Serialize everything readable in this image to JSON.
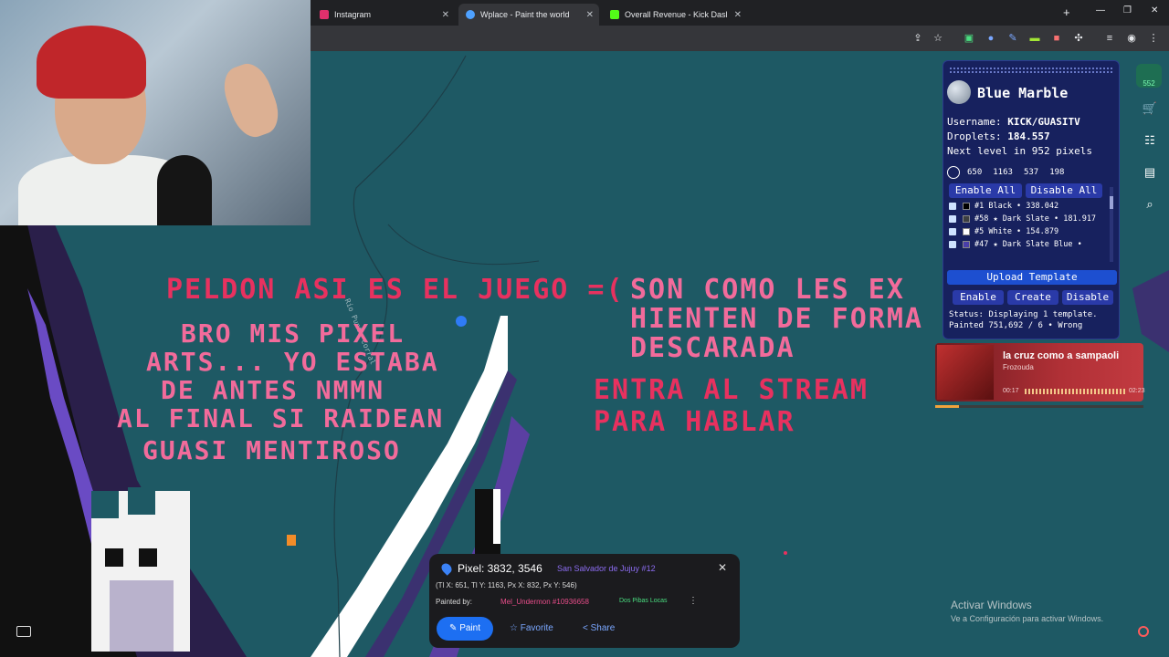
{
  "browser": {
    "tabs": [
      {
        "label": "Instagram",
        "color": "#e1306c"
      },
      {
        "label": "Wplace - Paint the world",
        "color": "#4ea1ff"
      },
      {
        "label": "Overall Revenue - Kick Dashbo",
        "color": "#53fc18"
      }
    ]
  },
  "canvas_text": {
    "line1a": "PELDON ASI ES EL JUEGO =(",
    "line1b": "SON COMO LES EX",
    "line2": "HIENTEN DE FORMA",
    "line3": "DESCARADA",
    "left1": "BRO MIS PIXEL",
    "left2": "ARTS... YO ESTABA",
    "left3": "DE ANTES NMMN",
    "left4": "AL FINAL SI RAIDEAN",
    "left5": "GUASI MENTIROSO",
    "right1": "ENTRA AL STREAM",
    "right2": "PARA HABLAR",
    "road": "Río Punta Corral"
  },
  "blue_marble": {
    "title": "Blue Marble",
    "username_label": "Username:",
    "username": "KICK/GUASITV",
    "droplets_label": "Droplets:",
    "droplets": "184.557",
    "next_level": "Next level in 952 pixels",
    "stats": [
      "650",
      "1163",
      "537",
      "198"
    ],
    "enable_all": "Enable All",
    "disable_all": "Disable All",
    "colors": [
      {
        "label": "#1 Black • 338.042",
        "swatch": "#000000"
      },
      {
        "label": "#58 ★ Dark Slate • 181.917",
        "swatch": "#3c3f41"
      },
      {
        "label": "#5 White • 154.879",
        "swatch": "#ffffff"
      },
      {
        "label": "#47 ★ Dark Slate Blue •",
        "swatch": "#4a3ea8"
      }
    ],
    "upload": "Upload Template",
    "enable": "Enable",
    "create": "Create",
    "disable": "Disable",
    "status": "Status: Displaying 1 template. Painted 751,692 / 6 • Wrong"
  },
  "sidebar": {
    "badge": "552"
  },
  "music": {
    "title": "la cruz como a sampaoli",
    "artist": "Frozouda",
    "elapsed": "00:17",
    "total": "02:23"
  },
  "pixel_info": {
    "coord": "Pixel: 3832, 3546",
    "place": "San Salvador de Jujuy #12",
    "tile": "(Tl X: 651, Tl Y: 1163, Px X: 832, Px Y: 546)",
    "painted_by": "Painted by:",
    "user": "Mel_Undermon #10936658",
    "alliance": "Dos Pibas Locas",
    "paint": "Paint",
    "favorite": "Favorite",
    "share": "Share"
  },
  "windows": {
    "line1": "Activar Windows",
    "line2": "Ve a Configuración para activar Windows."
  }
}
